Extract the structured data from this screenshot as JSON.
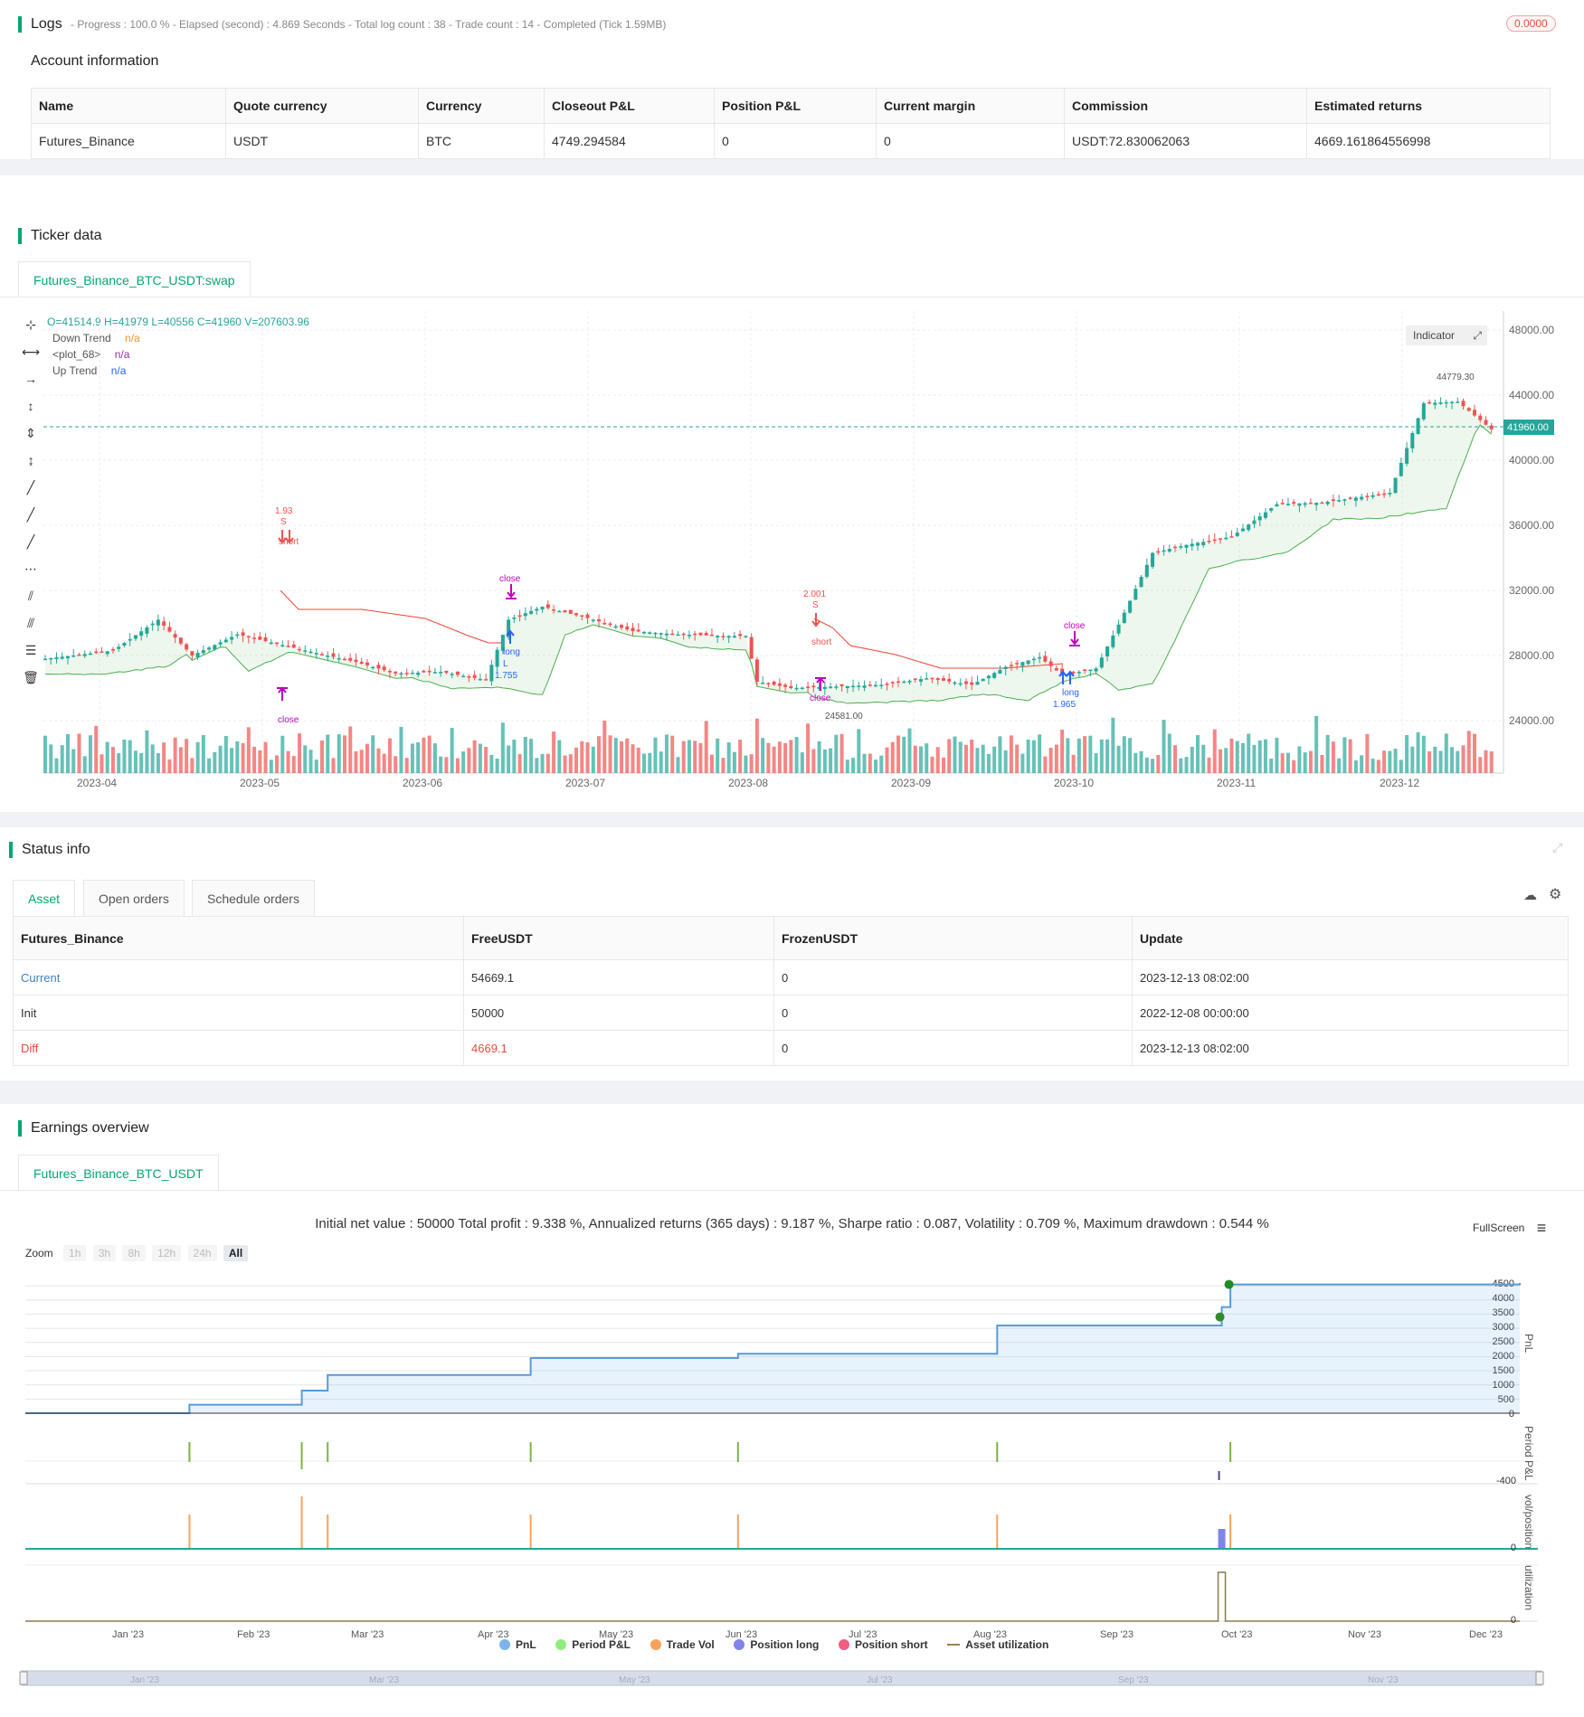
{
  "logs": {
    "title": "Logs",
    "summary": "- Progress : 100.0 % - Elapsed (second) : 4.869  Seconds - Total log count : 38 - Trade count : 14 - Completed (Tick 1.59MB)",
    "badge": "0.0000"
  },
  "account": {
    "title": "Account information",
    "headers": [
      "Name",
      "Quote currency",
      "Currency",
      "Closeout P&L",
      "Position P&L",
      "Current margin",
      "Commission",
      "Estimated returns"
    ],
    "row": [
      "Futures_Binance",
      "USDT",
      "BTC",
      "4749.294584",
      "0",
      "0",
      "USDT:72.830062063",
      "4669.161864556998"
    ]
  },
  "ticker": {
    "title": "Ticker data",
    "tab": "Futures_Binance_BTC_USDT:swap",
    "ohlc": "O=41514.9 H=41979 L=40556 C=41960 V=207603.96",
    "legend": [
      {
        "label": "Down Trend",
        "value": "n/a",
        "color": "#f7941d"
      },
      {
        "label": "<plot_68>",
        "value": "n/a",
        "color": "#9c27b0"
      },
      {
        "label": "Up Trend",
        "value": "n/a",
        "color": "#2962ff"
      }
    ],
    "indicator_button": "Indicator",
    "price_labels": [
      "48000.00",
      "44000.00",
      "40000.00",
      "36000.00",
      "32000.00",
      "28000.00",
      "24000.00"
    ],
    "last_price": "41960.00",
    "x_labels": [
      "2023-04",
      "2023-05",
      "2023-06",
      "2023-07",
      "2023-08",
      "2023-09",
      "2023-10",
      "2023-11",
      "2023-12"
    ],
    "annotations": {
      "high": "44779.30",
      "low": "24581.00",
      "short1_qty": "1.93",
      "short1_s": "S",
      "short1_label": "short",
      "close1": "close",
      "close_top": "close",
      "long1_label": "long",
      "long1_l": "L",
      "long1_qty": "1.755",
      "short2_qty": "2.001",
      "short2_s": "S",
      "short2_label": "short",
      "close2": "close",
      "close3": "close",
      "long2_label": "long",
      "long2_qty": "1.965"
    },
    "colors": {
      "up": "#26a69a",
      "down": "#ef5350",
      "up_trend": "#4caf50",
      "down_trend": "#f44336",
      "accent": "#00a86b"
    }
  },
  "status": {
    "title": "Status info",
    "tabs": [
      "Asset",
      "Open orders",
      "Schedule orders"
    ],
    "headers": [
      "Futures_Binance",
      "FreeUSDT",
      "FrozenUSDT",
      "Update"
    ],
    "rows": [
      {
        "name": "Current",
        "free": "54669.1",
        "frozen": "0",
        "update": "2023-12-13 08:02:00"
      },
      {
        "name": "Init",
        "free": "50000",
        "frozen": "0",
        "update": "2022-12-08 00:00:00"
      },
      {
        "name": "Diff",
        "free": "4669.1",
        "frozen": "0",
        "update": "2023-12-13 08:02:00"
      }
    ]
  },
  "earnings": {
    "title": "Earnings overview",
    "tab": "Futures_Binance_BTC_USDT",
    "summary": "Initial net value : 50000 Total profit : 9.338 %, Annualized returns (365 days) : 9.187 %, Sharpe ratio : 0.087, Volatility : 0.709 %, Maximum drawdown : 0.544 %",
    "fullscreen": "FullScreen",
    "zoom_label": "Zoom",
    "zoom_buttons": [
      "1h",
      "3h",
      "8h",
      "12h",
      "24h",
      "All"
    ],
    "pnl_ticks": [
      "4500",
      "4000",
      "3500",
      "3000",
      "2500",
      "2000",
      "1500",
      "1000",
      "500",
      "0"
    ],
    "axis_titles": [
      "PnL",
      "Period P&L",
      "vol/position",
      "utilization"
    ],
    "period_tick": "-400",
    "zero_a": "0",
    "zero_b": "0",
    "x_labels": [
      "Jan '23",
      "Feb '23",
      "Mar '23",
      "Apr '23",
      "May '23",
      "Jun '23",
      "Jul '23",
      "Aug '23",
      "Sep '23",
      "Oct '23",
      "Nov '23",
      "Dec '23"
    ],
    "nav_labels": [
      "Jan '23",
      "Mar '23",
      "May '23",
      "Jul '23",
      "Sep '23",
      "Nov '23"
    ],
    "legend": [
      {
        "label": "PnL",
        "color": "#7cb5ec"
      },
      {
        "label": "Period P&L",
        "color": "#90ed7d"
      },
      {
        "label": "Trade Vol",
        "color": "#f7a35c"
      },
      {
        "label": "Position long",
        "color": "#8085e9"
      },
      {
        "label": "Position short",
        "color": "#f15c80"
      },
      {
        "label": "Asset utilization",
        "color": "#a08050"
      }
    ]
  },
  "chart_data": {
    "type": "line",
    "title": "",
    "xlabel": "",
    "ylabel": "PnL",
    "x": [
      "2023-01-01",
      "2023-02-08",
      "2023-03-06",
      "2023-03-12",
      "2023-04-28",
      "2023-06-15",
      "2023-08-14",
      "2023-10-05",
      "2023-10-07",
      "2023-12-13"
    ],
    "values": [
      0,
      300,
      800,
      1350,
      1950,
      2100,
      3100,
      3750,
      4550,
      4600
    ],
    "ylim": [
      0,
      4600
    ]
  }
}
